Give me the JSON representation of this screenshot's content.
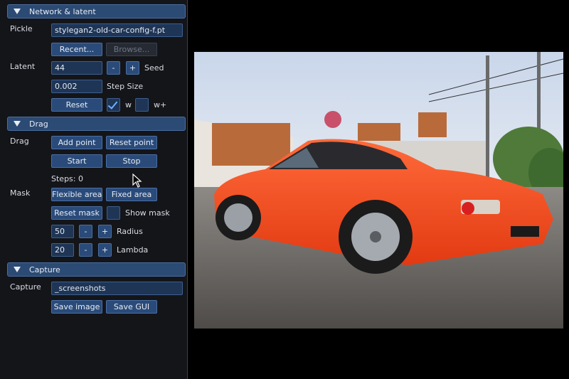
{
  "sections": {
    "network": "Network & latent",
    "drag": "Drag",
    "capture": "Capture"
  },
  "network": {
    "pickle_label": "Pickle",
    "pickle_value": "stylegan2-old-car-config-f.pt",
    "recent_button": "Recent...",
    "browse_button": "Browse...",
    "latent_label": "Latent",
    "seed_value": "44",
    "seed_minus": "-",
    "seed_plus": "+",
    "seed_label": "Seed",
    "step_value": "0.002",
    "step_label": "Step Size",
    "reset_button": "Reset",
    "w_checked": true,
    "w_label": "w",
    "wplus_checked": false,
    "wplus_label": "w+"
  },
  "drag": {
    "drag_label": "Drag",
    "add_point": "Add point",
    "reset_point": "Reset point",
    "start": "Start",
    "stop": "Stop",
    "steps": "Steps: 0",
    "mask_label": "Mask",
    "flexible_area": "Flexible area",
    "fixed_area": "Fixed area",
    "reset_mask": "Reset mask",
    "show_mask_checked": false,
    "show_mask_label": "Show mask",
    "radius_value": "50",
    "radius_minus": "-",
    "radius_plus": "+",
    "radius_label": "Radius",
    "lambda_value": "20",
    "lambda_minus": "-",
    "lambda_plus": "+",
    "lambda_label": "Lambda"
  },
  "capture": {
    "capture_label": "Capture",
    "dir_value": "_screenshots",
    "save_image": "Save image",
    "save_gui": "Save GUI"
  },
  "colors": {
    "panel_bg": "#141519",
    "header_bg": "#2b4a74",
    "button_bg": "#2a4b7a",
    "input_bg": "#1e3556",
    "car_body": "#ff4a1c"
  }
}
